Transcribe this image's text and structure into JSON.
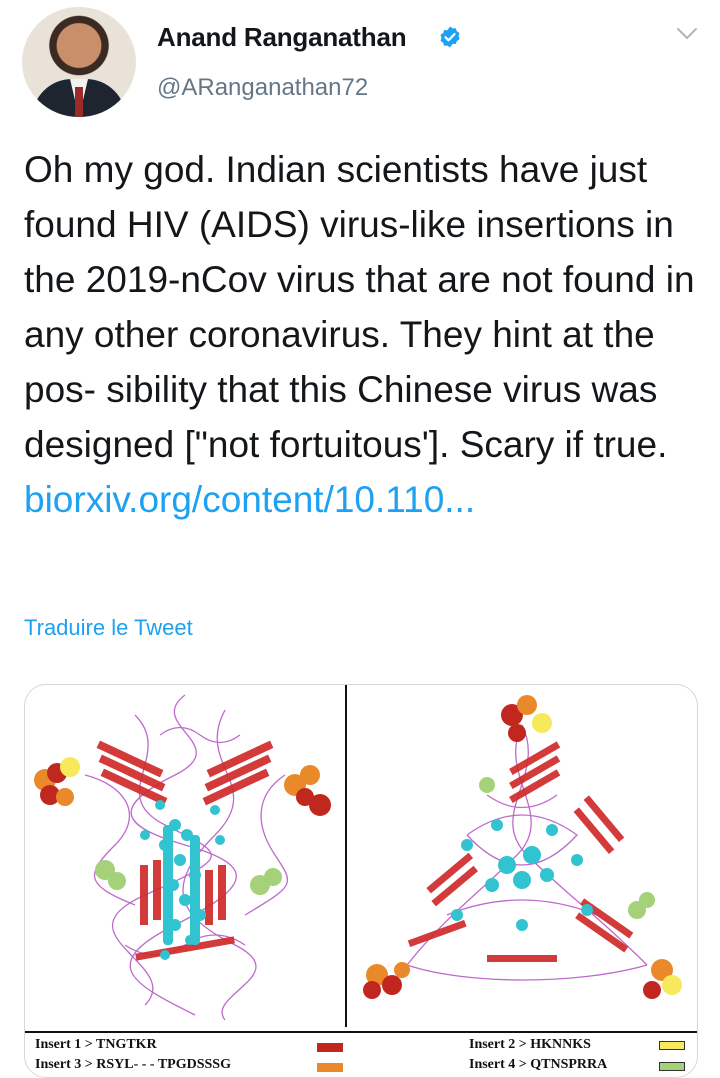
{
  "tweet": {
    "author_name": "Anand Ranganathan",
    "handle": "@ARanganathan72",
    "text_main": "Oh my god. Indian scientists have just found HIV (AIDS) virus-like insertions in the 2019-nCov virus that are not found in any other coronavirus. They hint at the pos- sibility that this Chinese virus was designed [\"not fortuitous']. Scary if true.",
    "link_text": "biorxiv.org/content/10.110...",
    "translate_label": "Traduire le Tweet"
  },
  "icons": {
    "verified": "verified-badge-icon",
    "more": "chevron-down-icon"
  },
  "media": {
    "legend": [
      {
        "label": "Insert 1 > TNGTKR",
        "color": "#c0281f"
      },
      {
        "label": "Insert 3 > RSYL- - - TPGDSSSG",
        "color": "#e9892a"
      },
      {
        "label": "Insert 2 > HKNNKS",
        "color": "#f6ea5c"
      },
      {
        "label": "Insert 4 > QTNSPRRA",
        "color": "#a4d17a"
      }
    ],
    "colors": {
      "strand": "#d02a2a",
      "helix": "#31c3cf",
      "coil": "#b75ac7"
    }
  }
}
